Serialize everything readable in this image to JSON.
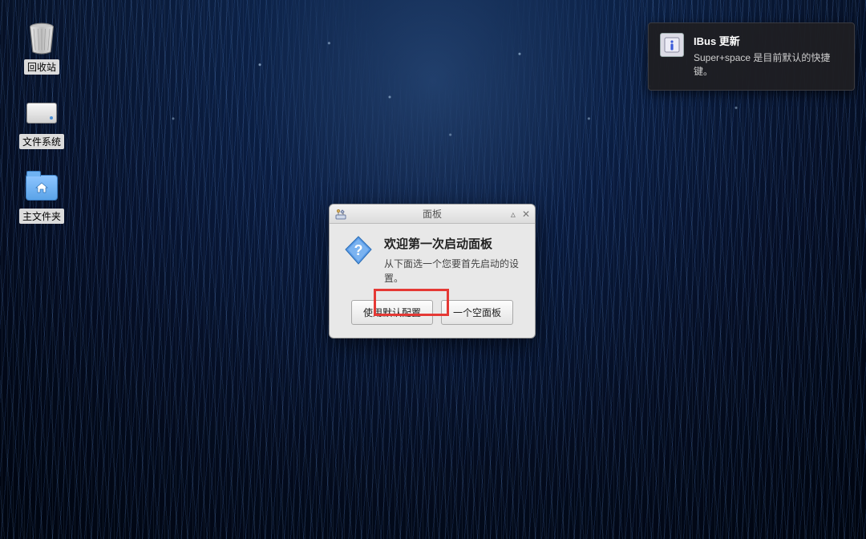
{
  "desktop": {
    "icons": [
      {
        "name": "trash",
        "label": "回收站"
      },
      {
        "name": "filesystem",
        "label": "文件系统"
      },
      {
        "name": "home",
        "label": "主文件夹"
      }
    ]
  },
  "notification": {
    "title": "IBus 更新",
    "message": "Super+space 是目前默认的快捷键。"
  },
  "dialog": {
    "window_title": "面板",
    "heading": "欢迎第一次启动面板",
    "subtext": "从下面选一个您要首先启动的设置。",
    "buttons": {
      "use_default": "使用默认配置",
      "empty_panel": "一个空面板"
    }
  },
  "highlight": {
    "target": "use_default_button"
  }
}
